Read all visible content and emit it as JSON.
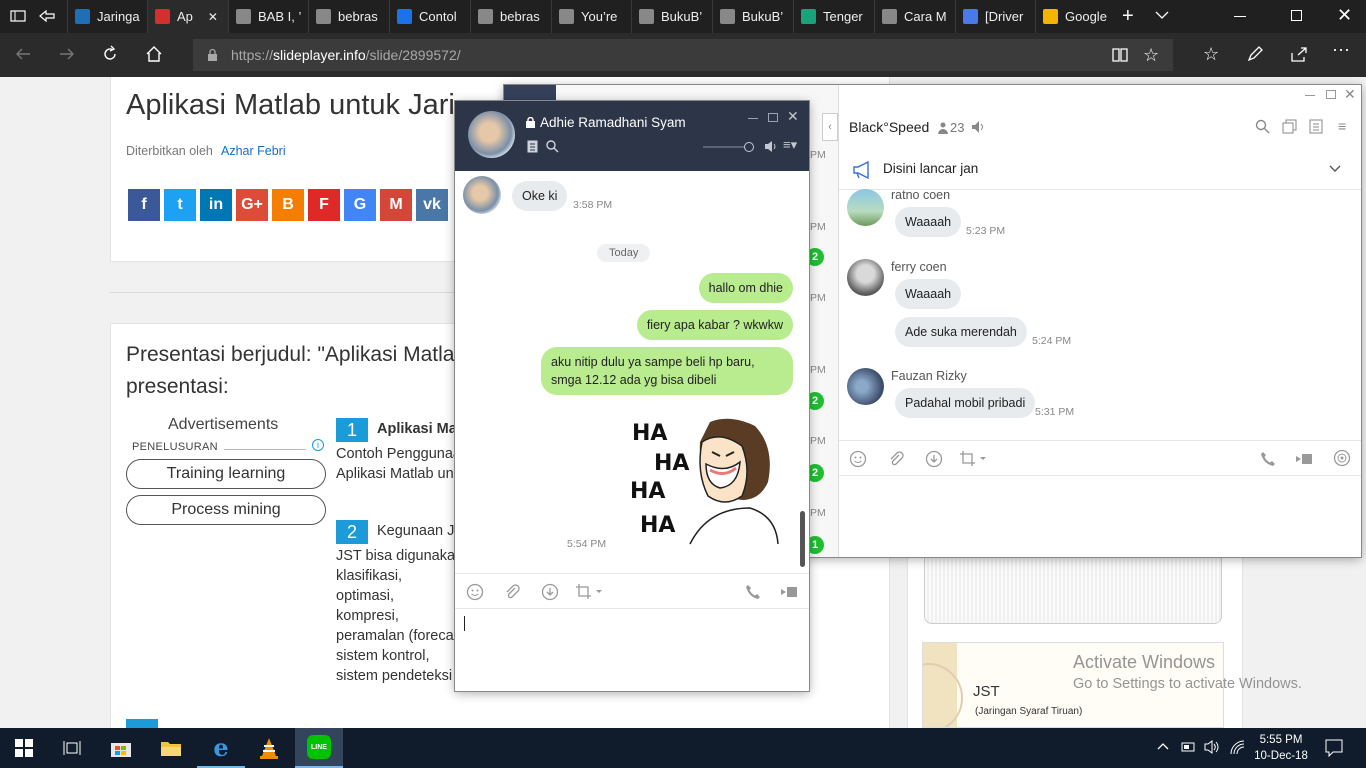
{
  "browser": {
    "tabs": [
      {
        "label": "Jaringa",
        "icon": "jaringan-favicon",
        "color": "#1e6fb8",
        "active": false
      },
      {
        "label": "Ap",
        "icon": "slideplayer-favicon",
        "color": "#d32f2f",
        "active": true
      },
      {
        "label": "BAB I, ’",
        "icon": "page-favicon",
        "color": "#888888",
        "active": false
      },
      {
        "label": "bebras",
        "icon": "page-favicon",
        "color": "#888888",
        "active": false
      },
      {
        "label": "Contol",
        "icon": "blogger-favicon",
        "color": "#1a73e8",
        "active": false
      },
      {
        "label": "bebras",
        "icon": "page-favicon",
        "color": "#888888",
        "active": false
      },
      {
        "label": "You’re",
        "icon": "page-favicon",
        "color": "#888888",
        "active": false
      },
      {
        "label": "BukuB’",
        "icon": "pdf-favicon",
        "color": "#888888",
        "active": false
      },
      {
        "label": "BukuB’",
        "icon": "pdf-favicon",
        "color": "#888888",
        "active": false
      },
      {
        "label": "Tenger",
        "icon": "tengger-favicon",
        "color": "#1aa37a",
        "active": false
      },
      {
        "label": "Cara M",
        "icon": "page-favicon",
        "color": "#888888",
        "active": false
      },
      {
        "label": "[Driver",
        "icon": "doc-favicon",
        "color": "#4a7ae8",
        "active": false
      },
      {
        "label": "Google",
        "icon": "drive-favicon",
        "color": "#f4b400",
        "active": false
      }
    ],
    "url_prefix": "https://",
    "url_domain": "slideplayer.info",
    "url_path": "/slide/2899572/"
  },
  "page": {
    "title": "Aplikasi Matlab untuk Jari",
    "published_by_label": "Diterbitkan oleh",
    "author": "Azhar Febri",
    "share_buttons": [
      {
        "icon": "facebook-icon",
        "glyph": "f",
        "color": "#3b5998"
      },
      {
        "icon": "twitter-icon",
        "glyph": "t",
        "color": "#1da1f2"
      },
      {
        "icon": "linkedin-icon",
        "glyph": "in",
        "color": "#0077b5"
      },
      {
        "icon": "googleplus-icon",
        "glyph": "G+",
        "color": "#dd4b39"
      },
      {
        "icon": "blogger-icon",
        "glyph": "B",
        "color": "#f57d00"
      },
      {
        "icon": "flipboard-icon",
        "glyph": "F",
        "color": "#e12828"
      },
      {
        "icon": "google-icon",
        "glyph": "G",
        "color": "#4285f4"
      },
      {
        "icon": "gmail-icon",
        "glyph": "M",
        "color": "#d44638"
      },
      {
        "icon": "vk-icon",
        "glyph": "vk",
        "color": "#4a76a8"
      }
    ],
    "section_title_1": "Presentasi berjudul: \"Aplikasi Matla",
    "section_title_2": "presentasi:",
    "ads_label": "Advertisements",
    "search_label": "PENELUSURAN",
    "ad_pills": [
      "Training learning",
      "Process mining"
    ],
    "slide1_number": "1",
    "slide1_title": "Aplikasi Ma",
    "slide1_line1": "Contoh Penggunaa",
    "slide1_line2": "Aplikasi Matlab un",
    "slide2_number": "2",
    "slide2_title": "Kegunaan JS",
    "slide2_lines": [
      "JST bisa digunakan",
      "klasifikasi,",
      "optimasi,",
      "kompresi,",
      "peramalan (foreca",
      "sistem kontrol,",
      "sistem pendeteksi"
    ],
    "thumb_title": "JST",
    "thumb_subtitle": "(Jaringan Syaraf Tiruan)",
    "watermark_line1": "Activate Windows",
    "watermark_line2": "Go to Settings to activate Windows."
  },
  "chat": {
    "contact_name": "Adhie Ramadhani Syam",
    "messages_in": [
      {
        "text": "Oke ki",
        "time": "3:58 PM"
      }
    ],
    "date_divider": "Today",
    "messages_out": [
      {
        "text": "hallo om dhie"
      },
      {
        "text": "fiery apa kabar ? wkwkw"
      },
      {
        "text": "aku nitip dulu ya sampe beli hp baru, smga 12.12 ada yg bisa dibeli"
      }
    ],
    "sticker_text": [
      "HA",
      "HA",
      "HA",
      "HA"
    ],
    "sticker_time": "5:54 PM",
    "input_value": ""
  },
  "group": {
    "name": "Black°Speed",
    "member_count": "23",
    "announcement": "Disini lancar jan",
    "messages": [
      {
        "sender": "ratno coen",
        "text": "Waaaah",
        "time": "5:23 PM"
      },
      {
        "sender": "ferry coen",
        "text": "Waaaah",
        "time": ""
      },
      {
        "sender": "",
        "text": "Ade suka merendah",
        "time": "5:24 PM"
      },
      {
        "sender": "Fauzan Rizky",
        "text": "Padahal mobil pribadi",
        "time": "5:31 PM"
      }
    ],
    "list_times": [
      "PM",
      "PM",
      "PM",
      "PM",
      "PM",
      "PM",
      "PM",
      "PM"
    ],
    "list_badges": [
      "2",
      "2",
      "2",
      "1"
    ]
  },
  "taskbar": {
    "time": "5:55 PM",
    "date": "10-Dec-18"
  }
}
